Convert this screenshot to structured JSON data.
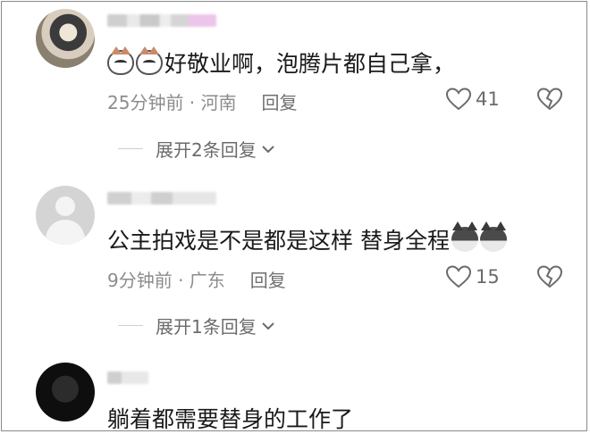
{
  "comments": [
    {
      "avatar": "blurred-photo",
      "text": "好敬业啊，泡腾片都自己拿，",
      "emojis": [
        "cat-icon",
        "cat-icon"
      ],
      "time": "25分钟前 · 河南",
      "reply_label": "回复",
      "likes": "41",
      "expand_label": "展开2条回复"
    },
    {
      "avatar": "default-user",
      "text": "公主拍戏是不是都是这样 替身全程",
      "emojis": [
        "dog-icon",
        "dog-icon"
      ],
      "time": "9分钟前 · 广东",
      "reply_label": "回复",
      "likes": "15",
      "expand_label": "展开1条回复"
    },
    {
      "avatar": "dark-photo",
      "text": "躺着都需要替身的工作了"
    }
  ]
}
